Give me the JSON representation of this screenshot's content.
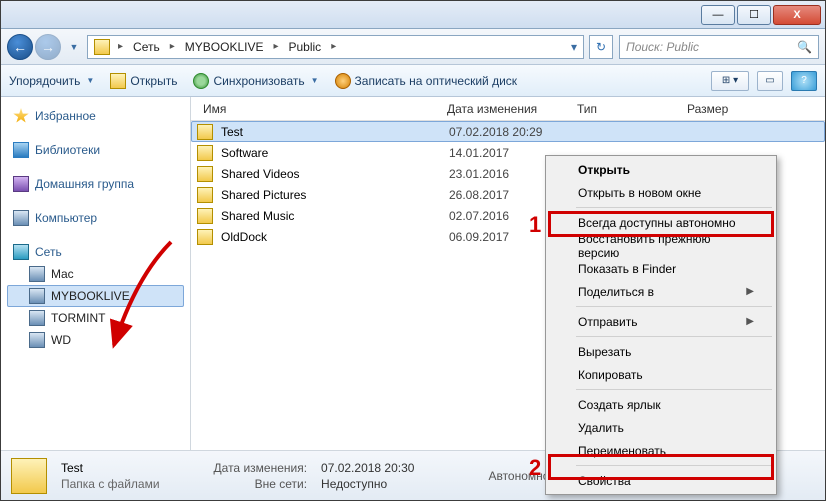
{
  "window": {
    "min": "—",
    "max": "☐",
    "close": "X"
  },
  "breadcrumb": {
    "root": "Сеть",
    "l1": "MYBOOKLIVE",
    "l2": "Public"
  },
  "search": {
    "placeholder": "Поиск: Public"
  },
  "toolbar": {
    "organize": "Упорядочить",
    "open": "Открыть",
    "sync": "Синхронизовать",
    "burn": "Записать на оптический диск"
  },
  "sidebar": {
    "favorites": "Избранное",
    "libraries": "Библиотеки",
    "homegroup": "Домашняя группа",
    "computer": "Компьютер",
    "network": "Сеть",
    "net_items": [
      "Mac",
      "MYBOOKLIVE",
      "TORMINT",
      "WD"
    ]
  },
  "columns": {
    "name": "Имя",
    "date": "Дата изменения",
    "type": "Тип",
    "size": "Размер"
  },
  "files": [
    {
      "name": "Test",
      "date": "07.02.2018 20:29",
      "sel": true
    },
    {
      "name": "Software",
      "date": "14.01.2017"
    },
    {
      "name": "Shared Videos",
      "date": "23.01.2016"
    },
    {
      "name": "Shared Pictures",
      "date": "26.08.2017"
    },
    {
      "name": "Shared Music",
      "date": "02.07.2016"
    },
    {
      "name": "OldDock",
      "date": "06.09.2017"
    }
  ],
  "ctx": {
    "open": "Открыть",
    "open_new": "Открыть в новом окне",
    "offline": "Всегда доступны автономно",
    "restore": "Восстановить прежнюю версию",
    "finder": "Показать в Finder",
    "share": "Поделиться в",
    "send": "Отправить",
    "cut": "Вырезать",
    "copy": "Копировать",
    "shortcut": "Создать ярлык",
    "delete": "Удалить",
    "rename": "Переименовать",
    "props": "Свойства"
  },
  "status": {
    "title": "Test",
    "subtitle": "Папка с файлами",
    "date_lbl": "Дата изменения:",
    "date_val": "07.02.2018 20:30",
    "net_lbl": "Вне сети:",
    "net_val": "Недоступно",
    "auto_lbl": "Автономность:"
  },
  "markers": {
    "one": "1",
    "two": "2"
  }
}
